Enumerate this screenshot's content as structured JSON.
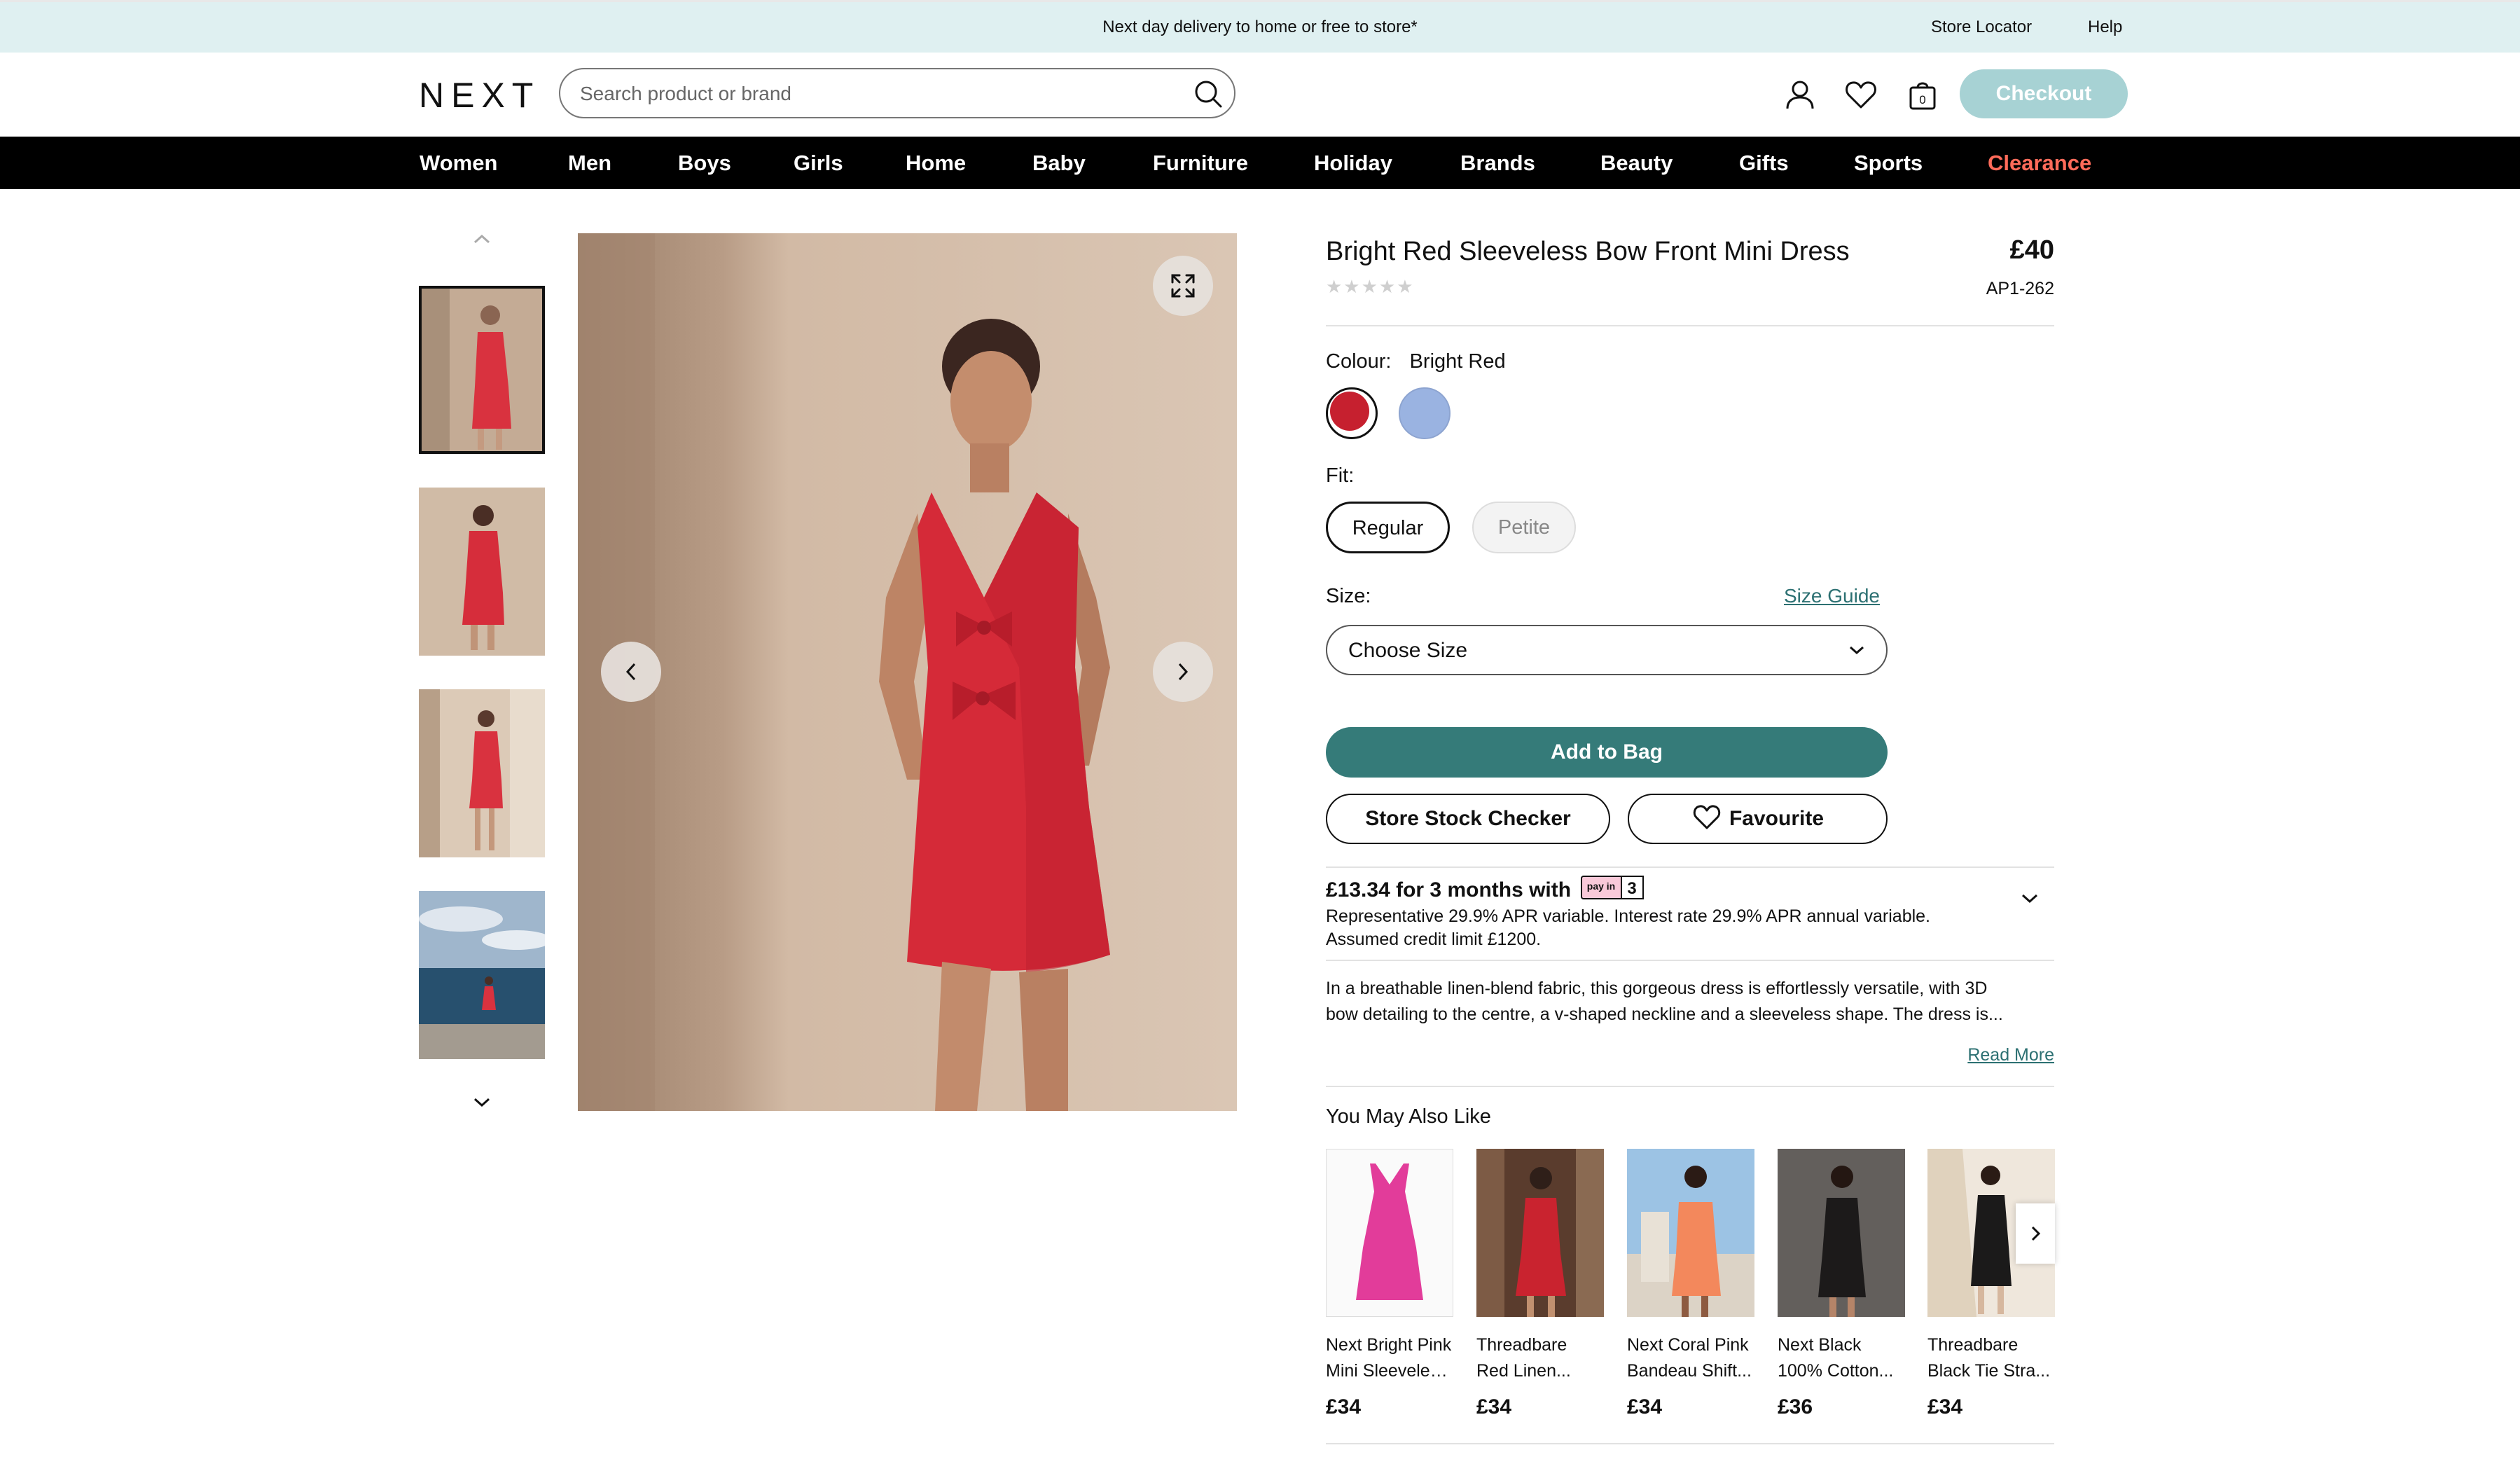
{
  "banner": {
    "message": "Next day delivery to home or free to store*",
    "store_locator": "Store Locator",
    "help": "Help"
  },
  "header": {
    "logo": "NEXT",
    "search_placeholder": "Search product or brand",
    "bag_count": "0",
    "checkout_label": "Checkout"
  },
  "nav": {
    "items": [
      "Women",
      "Men",
      "Boys",
      "Girls",
      "Home",
      "Baby",
      "Furniture",
      "Holiday",
      "Brands",
      "Beauty",
      "Gifts",
      "Sports",
      "Clearance"
    ]
  },
  "product": {
    "title": "Bright Red Sleeveless Bow Front Mini Dress",
    "price": "£40",
    "code": "AP1-262",
    "rating_stars": "★★★★★",
    "colour_label": "Colour:",
    "colour_value": "Bright Red",
    "swatches": [
      "#c6202f",
      "#9ab3e1"
    ],
    "fit_label": "Fit:",
    "fit_options": [
      "Regular",
      "Petite"
    ],
    "size_label": "Size:",
    "size_guide": "Size Guide",
    "size_select": "Choose Size",
    "add_to_bag": "Add to Bag",
    "store_stock": "Store Stock Checker",
    "favourite": "Favourite",
    "payin_text": "£13.34 for 3 months with",
    "payin_badge_small": "pay in",
    "payin_badge_num": "3",
    "representative": "Representative 29.9% APR variable. Interest rate 29.9% APR annual variable.",
    "credit_limit": "Assumed credit limit £1200.",
    "description_line1": "In a breathable linen-blend fabric, this gorgeous dress is effortlessly versatile, with 3D",
    "description_line2": "bow detailing to the centre, a v-shaped neckline and a sleeveless shape. The dress is...",
    "read_more": "Read More"
  },
  "recommendations": {
    "heading": "You May Also Like",
    "items": [
      {
        "line1": "Next Bright Pink",
        "line2": "Mini Sleeveles...",
        "price": "£34"
      },
      {
        "line1": "Threadbare",
        "line2": "Red Linen...",
        "price": "£34"
      },
      {
        "line1": "Next Coral Pink",
        "line2": "Bandeau Shift...",
        "price": "£34"
      },
      {
        "line1": "Next Black",
        "line2": "100% Cotton...",
        "price": "£36"
      },
      {
        "line1": "Threadbare",
        "line2": "Black Tie Stra...",
        "price": "£34"
      }
    ]
  },
  "colors": {
    "teal": "#357b79",
    "checkout": "#a7d2d4",
    "clearance": "#ff6b5a",
    "banner": "#dff0f1"
  }
}
